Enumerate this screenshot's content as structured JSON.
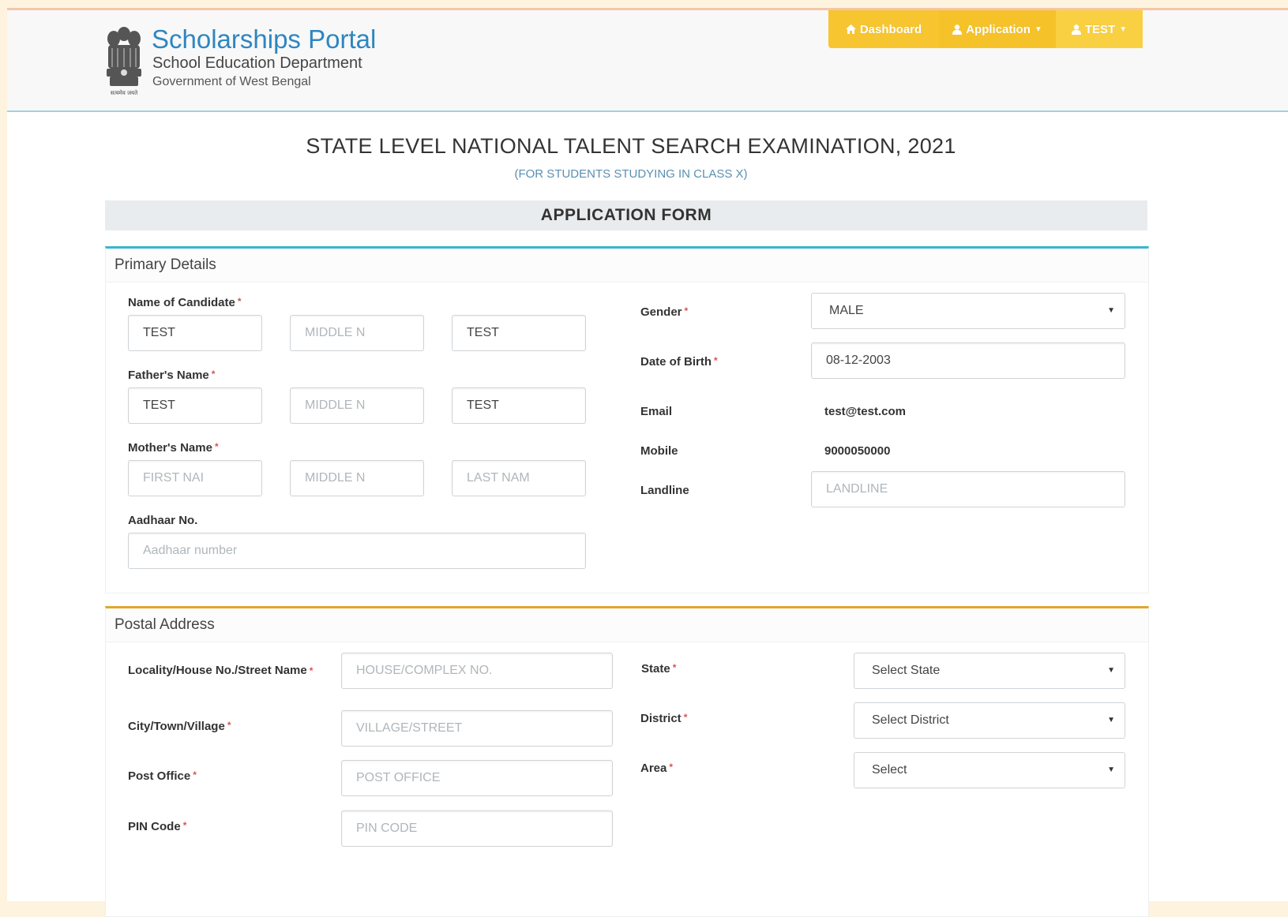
{
  "header": {
    "title": "Scholarships Portal",
    "subtitle": "School Education Department",
    "org": "Government of West Bengal",
    "emblem_text": "सत्यमेव जयते"
  },
  "nav": {
    "dashboard": "Dashboard",
    "application": "Application",
    "user": "TEST"
  },
  "page": {
    "title": "STATE LEVEL NATIONAL TALENT SEARCH EXAMINATION, 2021",
    "subtitle": "(FOR STUDENTS STUDYING IN CLASS X)",
    "form_heading": "APPLICATION FORM"
  },
  "primary": {
    "section_title": "Primary Details",
    "candidate_label": "Name of Candidate",
    "candidate": {
      "first": "TEST",
      "middle_placeholder": "MIDDLE N",
      "last": "TEST"
    },
    "father_label": "Father's Name",
    "father": {
      "first": "TEST",
      "middle_placeholder": "MIDDLE N",
      "last": "TEST"
    },
    "mother_label": "Mother's Name",
    "mother": {
      "first_placeholder": "FIRST NAI",
      "middle_placeholder": "MIDDLE N",
      "last_placeholder": "LAST NAM"
    },
    "aadhaar_label": "Aadhaar No.",
    "aadhaar_placeholder": "Aadhaar number",
    "gender_label": "Gender",
    "gender_value": "MALE",
    "dob_label": "Date of Birth",
    "dob_value": "08-12-2003",
    "email_label": "Email",
    "email_value": "test@test.com",
    "mobile_label": "Mobile",
    "mobile_value": "9000050000",
    "landline_label": "Landline",
    "landline_placeholder": "LANDLINE",
    "required_mark": "*"
  },
  "postal": {
    "section_title": "Postal Address",
    "locality_label": "Locality/House No./Street Name",
    "locality_placeholder": "HOUSE/COMPLEX NO.",
    "city_label": "City/Town/Village",
    "city_placeholder": "VILLAGE/STREET",
    "post_label": "Post Office",
    "post_placeholder": "POST OFFICE",
    "pin_label": "PIN Code",
    "pin_placeholder": "PIN CODE",
    "state_label": "State",
    "state_value": "Select State",
    "district_label": "District",
    "district_value": "Select District",
    "area_label": "Area",
    "area_value": "Select"
  }
}
